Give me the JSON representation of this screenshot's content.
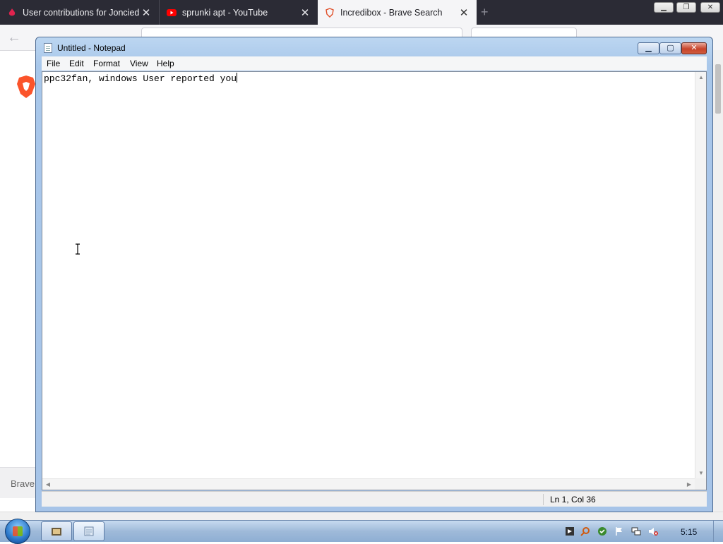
{
  "browser": {
    "tabs": [
      {
        "label": "User contributions for Joncied |",
        "active": false,
        "icon": "fandom-flame-icon"
      },
      {
        "label": "sprunki apt - YouTube",
        "active": false,
        "icon": "youtube-icon"
      },
      {
        "label": "Incredibox - Brave Search",
        "active": true,
        "icon": "brave-shield-icon"
      }
    ],
    "footer_text": "Brave"
  },
  "notepad": {
    "title": "Untitled - Notepad",
    "menu": {
      "file": "File",
      "edit": "Edit",
      "format": "Format",
      "view": "View",
      "help": "Help"
    },
    "text": "ppc32fan, windows User reported you",
    "status": "Ln 1, Col 36"
  },
  "taskbar": {
    "clock": "5:15"
  },
  "colors": {
    "tabstrip": "#2b2b35",
    "window_frame": "#a8c7ea",
    "taskbar": "#9fbad9",
    "close_button": "#c7442b"
  }
}
